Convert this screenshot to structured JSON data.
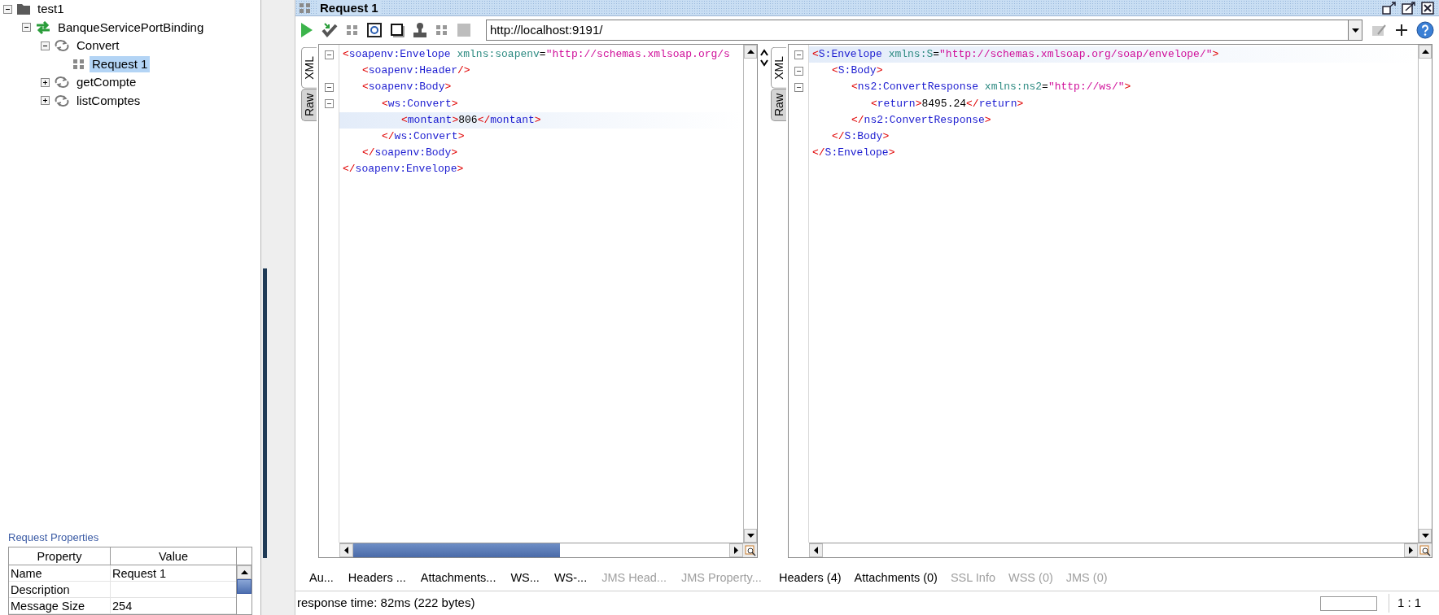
{
  "tree": [
    {
      "label": "test1",
      "kind": "project",
      "expanded": true,
      "selected": false,
      "children": [
        {
          "label": "BanqueServicePortBinding",
          "kind": "interface",
          "expanded": true,
          "selected": false,
          "children": [
            {
              "label": "Convert",
              "kind": "operation",
              "expanded": true,
              "selected": false,
              "children": [
                {
                  "label": "Request 1",
                  "kind": "request",
                  "selected": true
                }
              ]
            },
            {
              "label": "getCompte",
              "kind": "operation",
              "expanded": false,
              "selected": false
            },
            {
              "label": "listComptes",
              "kind": "operation",
              "expanded": false,
              "selected": false
            }
          ]
        }
      ]
    }
  ],
  "properties": {
    "title": "Request Properties",
    "columns": [
      "Property",
      "Value"
    ],
    "rows": [
      {
        "property": "Name",
        "value": "Request 1"
      },
      {
        "property": "Description"
      },
      {
        "property": "Message Size",
        "value": "254"
      }
    ]
  },
  "window": {
    "title": "Request 1"
  },
  "toolbar": {
    "endpoint": "http://localhost:9191/"
  },
  "editors": [
    {
      "view_tabs": [
        {
          "label": "XML",
          "selected": true
        },
        {
          "label": "Raw",
          "selected": false
        }
      ],
      "lines": [
        {
          "fold": true,
          "highlighted": false,
          "segments": [
            {
              "kind": "punct",
              "text": "<"
            },
            {
              "kind": "tag",
              "text": "soapenv:Envelope"
            },
            {
              "kind": "attr",
              "text": "xmlns:soapenv"
            },
            {
              "kind": "eq",
              "text": "="
            },
            {
              "kind": "value",
              "text": "\"http://schemas.xmlsoap.org/s"
            }
          ],
          "children": [
            {
              "fold": false,
              "highlighted": false,
              "segments": [
                {
                  "kind": "punct",
                  "text": "<"
                },
                {
                  "kind": "tag",
                  "text": "soapenv:Header"
                },
                {
                  "kind": "punct",
                  "text": "/>"
                }
              ]
            },
            {
              "fold": true,
              "highlighted": false,
              "segments": [
                {
                  "kind": "punct",
                  "text": "<"
                },
                {
                  "kind": "tag",
                  "text": "soapenv:Body"
                },
                {
                  "kind": "punct",
                  "text": ">"
                }
              ],
              "children": [
                {
                  "fold": true,
                  "highlighted": false,
                  "segments": [
                    {
                      "kind": "punct",
                      "text": "<"
                    },
                    {
                      "kind": "tag",
                      "text": "ws:Convert"
                    },
                    {
                      "kind": "punct",
                      "text": ">"
                    }
                  ],
                  "children": [
                    {
                      "fold": false,
                      "highlighted": true,
                      "segments": [
                        {
                          "kind": "punct",
                          "text": "<"
                        },
                        {
                          "kind": "tag",
                          "text": "montant"
                        },
                        {
                          "kind": "punct",
                          "text": ">"
                        },
                        {
                          "kind": "text",
                          "text": "806"
                        },
                        {
                          "kind": "punct",
                          "text": "</"
                        },
                        {
                          "kind": "tag",
                          "text": "montant"
                        },
                        {
                          "kind": "punct",
                          "text": ">"
                        }
                      ]
                    }
                  ]
                },
                {
                  "fold": false,
                  "highlighted": false,
                  "segments": [
                    {
                      "kind": "punct",
                      "text": "</"
                    },
                    {
                      "kind": "tag",
                      "text": "ws:Convert"
                    },
                    {
                      "kind": "punct",
                      "text": ">"
                    }
                  ]
                }
              ]
            },
            {
              "fold": false,
              "highlighted": false,
              "segments": [
                {
                  "kind": "punct",
                  "text": "</"
                },
                {
                  "kind": "tag",
                  "text": "soapenv:Body"
                },
                {
                  "kind": "punct",
                  "text": ">"
                }
              ]
            }
          ]
        },
        {
          "fold": false,
          "highlighted": false,
          "segments": [
            {
              "kind": "punct",
              "text": "</"
            },
            {
              "kind": "tag",
              "text": "soapenv:Envelope"
            },
            {
              "kind": "punct",
              "text": ">"
            }
          ]
        }
      ],
      "bottom_tabs": [
        {
          "label": "Au...",
          "disabled": false
        },
        {
          "label": "Headers ...",
          "disabled": false
        },
        {
          "label": "Attachments...",
          "disabled": false
        },
        {
          "label": "WS...",
          "disabled": false
        },
        {
          "label": "WS-...",
          "disabled": false
        },
        {
          "label": "JMS Head...",
          "disabled": true
        },
        {
          "label": "JMS Property...",
          "disabled": true
        }
      ]
    },
    {
      "view_tabs": [
        {
          "label": "XML",
          "selected": true
        },
        {
          "label": "Raw",
          "selected": false
        }
      ],
      "lines": [
        {
          "fold": true,
          "highlighted": true,
          "segments": [
            {
              "kind": "punct",
              "text": "<"
            },
            {
              "kind": "tag",
              "text": "S:Envelope"
            },
            {
              "kind": "attr",
              "text": "xmlns:S"
            },
            {
              "kind": "eq",
              "text": "="
            },
            {
              "kind": "value",
              "text": "\"http://schemas.xmlsoap.org/soap/envelope/\""
            },
            {
              "kind": "punct",
              "text": ">"
            }
          ],
          "children": [
            {
              "fold": true,
              "highlighted": false,
              "segments": [
                {
                  "kind": "punct",
                  "text": "<"
                },
                {
                  "kind": "tag",
                  "text": "S:Body"
                },
                {
                  "kind": "punct",
                  "text": ">"
                }
              ],
              "children": [
                {
                  "fold": true,
                  "highlighted": false,
                  "segments": [
                    {
                      "kind": "punct",
                      "text": "<"
                    },
                    {
                      "kind": "tag",
                      "text": "ns2:ConvertResponse"
                    },
                    {
                      "kind": "attr",
                      "text": "xmlns:ns2"
                    },
                    {
                      "kind": "eq",
                      "text": "="
                    },
                    {
                      "kind": "value",
                      "text": "\"http://ws/\""
                    },
                    {
                      "kind": "punct",
                      "text": ">"
                    }
                  ],
                  "children": [
                    {
                      "fold": false,
                      "highlighted": false,
                      "segments": [
                        {
                          "kind": "punct",
                          "text": "<"
                        },
                        {
                          "kind": "tag",
                          "text": "return"
                        },
                        {
                          "kind": "punct",
                          "text": ">"
                        },
                        {
                          "kind": "text",
                          "text": "8495.24"
                        },
                        {
                          "kind": "punct",
                          "text": "</"
                        },
                        {
                          "kind": "tag",
                          "text": "return"
                        },
                        {
                          "kind": "punct",
                          "text": ">"
                        }
                      ]
                    }
                  ]
                },
                {
                  "fold": false,
                  "highlighted": false,
                  "segments": [
                    {
                      "kind": "punct",
                      "text": "</"
                    },
                    {
                      "kind": "tag",
                      "text": "ns2:ConvertResponse"
                    },
                    {
                      "kind": "punct",
                      "text": ">"
                    }
                  ]
                }
              ]
            },
            {
              "fold": false,
              "highlighted": false,
              "segments": [
                {
                  "kind": "punct",
                  "text": "</"
                },
                {
                  "kind": "tag",
                  "text": "S:Body"
                },
                {
                  "kind": "punct",
                  "text": ">"
                }
              ]
            }
          ]
        },
        {
          "fold": false,
          "highlighted": false,
          "segments": [
            {
              "kind": "punct",
              "text": "</"
            },
            {
              "kind": "tag",
              "text": "S:Envelope"
            },
            {
              "kind": "punct",
              "text": ">"
            }
          ]
        }
      ],
      "bottom_tabs": [
        {
          "label": "Headers (4)",
          "disabled": false
        },
        {
          "label": "Attachments (0)",
          "disabled": false
        },
        {
          "label": "SSL Info",
          "disabled": true
        },
        {
          "label": "WSS (0)",
          "disabled": true
        },
        {
          "label": "JMS (0)",
          "disabled": true
        }
      ]
    }
  ],
  "status_bar": {
    "message": "response time: 82ms (222 bytes)",
    "position": "1 : 1"
  }
}
